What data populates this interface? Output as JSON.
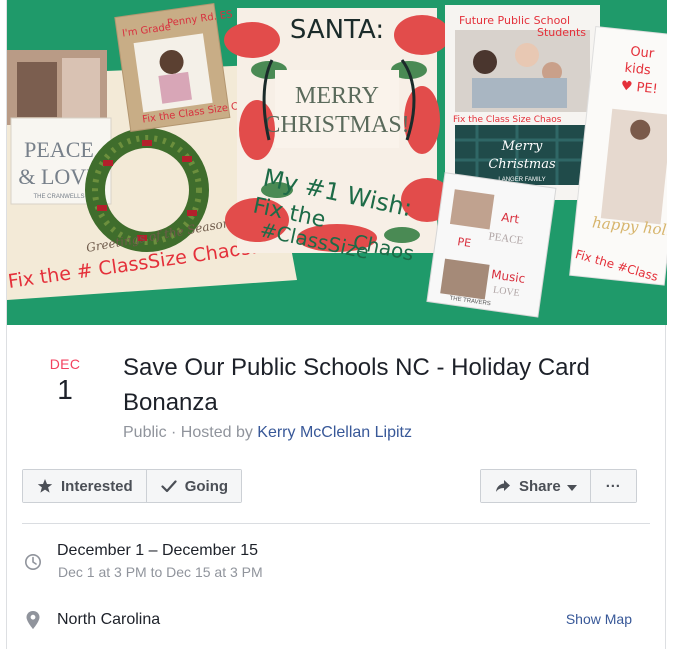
{
  "cover": {
    "left_card": {
      "line1": "PEACE",
      "line2": "& LOVE",
      "sub": "THE CRANWELLS",
      "cursive": "Greetings of the Season",
      "slogan": "Fix the # ClassSize Chaos:"
    },
    "small_card": {
      "note1": "I'm Grade",
      "note2": "Penny Rd. ES",
      "slogan": "Fix the Class Size Chaos"
    },
    "center_card": {
      "top": "SANTA:",
      "line1": "MERRY",
      "line2": "CHRISTMAS!",
      "wish": "My #1 Wish:",
      "fix1": "Fix the",
      "fix2": "#ClassSize",
      "fix3": "Chaos"
    },
    "right_card": {
      "top1": "Future Public School",
      "top2": "Students",
      "slogan": "Fix the Class Size Chaos",
      "cursive1": "Merry",
      "cursive2": "Christmas",
      "family": "LANGER FAMILY"
    },
    "mini_card": {
      "art": "Art",
      "pe": "PE",
      "peace": "PEACE",
      "music": "Music",
      "love": "LOVE",
      "family": "THE TRAVERS"
    },
    "far_right": {
      "top1": "Our",
      "top2": "kids",
      "top3": "♥ PE!",
      "cursive": "happy holidays",
      "slogan": "Fix the #Class"
    }
  },
  "event": {
    "month": "DEC",
    "day": "1",
    "title": "Save Our Public Schools NC - Holiday Card Bonanza",
    "privacy": "Public",
    "separator": " · ",
    "hosted_by_prefix": "Hosted by ",
    "host": "Kerry McClellan Lipitz"
  },
  "actions": {
    "interested": "Interested",
    "going": "Going",
    "share": "Share",
    "more": "···"
  },
  "details": {
    "date_range": "December 1 – December 15",
    "time_range": "Dec 1 at 3 PM to Dec 15 at 3 PM",
    "location": "North Carolina",
    "show_map": "Show Map"
  },
  "icons": {
    "interested": "star-icon",
    "going": "check-icon",
    "share": "share-arrow-icon",
    "share_caret": "caret-down-icon",
    "when": "clock-icon",
    "where": "location-pin-icon"
  },
  "colors": {
    "month": "#f3425f",
    "link": "#385898",
    "secondary_text": "#90949c",
    "primary_text": "#1d2129",
    "cover_background": "#1f9a6a",
    "slogan_red": "#e4303a",
    "marker_green": "#1d6b47"
  }
}
